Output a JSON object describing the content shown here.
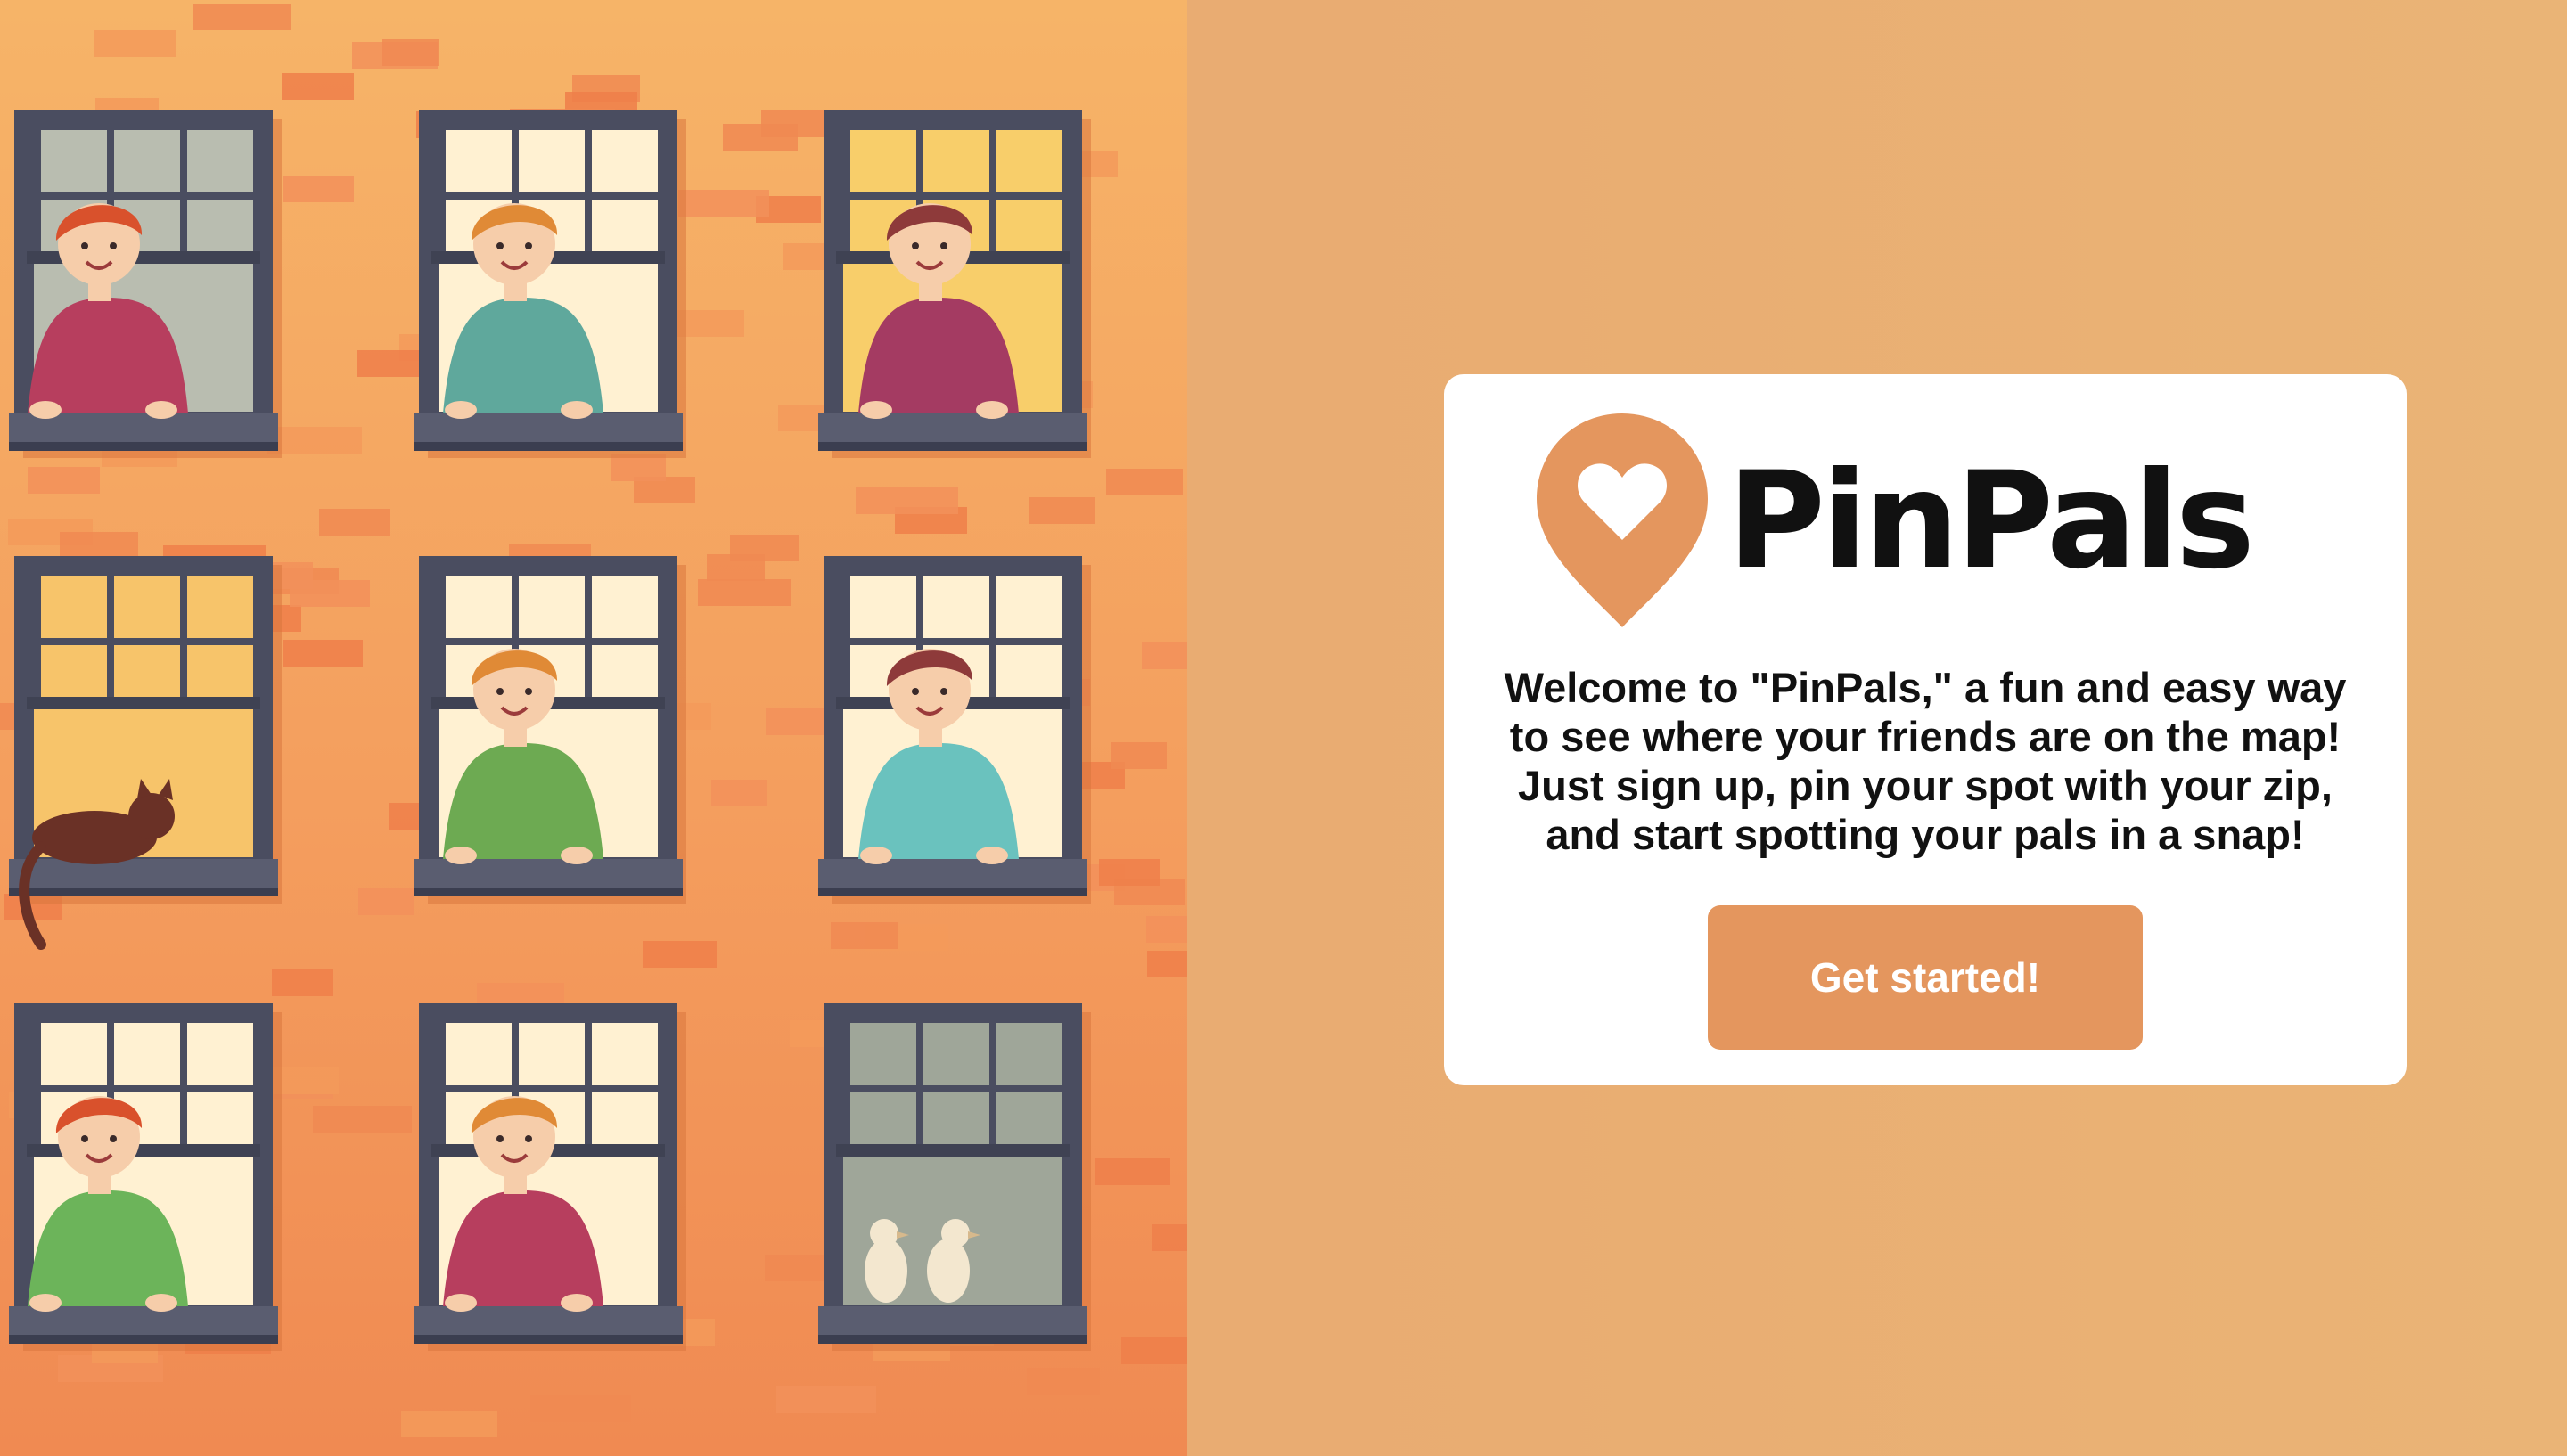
{
  "brand": {
    "name": "PinPals",
    "logo_icon": "heart-pin-icon",
    "accent_color": "#E4965E"
  },
  "welcome": {
    "message": "Welcome to \"PinPals,\" a fun and easy way to see where your friends are on the map! Just sign up, pin your spot with your zip, and start spotting your pals in a snap!"
  },
  "cta": {
    "label": "Get started!"
  },
  "colors": {
    "page_background": "#E9AD72",
    "card_background": "#FFFFFF",
    "button_background": "#E4965E",
    "button_text": "#FFFFFF",
    "brick_wall": "#F29A5C"
  },
  "illustration": {
    "icon": "apartment-windows-illustration",
    "windows": [
      "neighbor-watering-plant",
      "neighbor-leaning",
      "neighbor-with-tea",
      "cat-on-sill",
      "neighbor-with-mug",
      "neighbor-waving",
      "neighbor-with-plant",
      "neighbor-waving-woman",
      "birds-on-sill"
    ]
  }
}
